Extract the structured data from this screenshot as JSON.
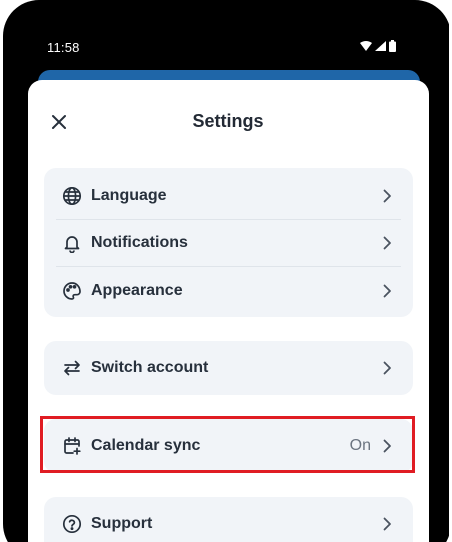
{
  "status_bar": {
    "time": "11:58",
    "icons": [
      "wifi-icon",
      "cellular-signal-icon",
      "battery-icon"
    ]
  },
  "header": {
    "title": "Settings",
    "close_icon": "close-icon"
  },
  "groups": {
    "general": {
      "items": [
        {
          "label": "Language",
          "icon": "globe-icon"
        },
        {
          "label": "Notifications",
          "icon": "bell-icon"
        },
        {
          "label": "Appearance",
          "icon": "palette-icon"
        }
      ]
    },
    "account": {
      "items": [
        {
          "label": "Switch account",
          "icon": "swap-arrows-icon"
        }
      ]
    },
    "calendar": {
      "items": [
        {
          "label": "Calendar sync",
          "value": "On",
          "icon": "calendar-add-icon"
        }
      ]
    },
    "help": {
      "items": [
        {
          "label": "Support",
          "icon": "help-circle-icon"
        }
      ]
    }
  },
  "colors": {
    "accent": "#1f66a8",
    "card_background": "#f1f4f8",
    "highlight_border": "#e01c23",
    "text_primary": "#27303c",
    "text_secondary": "#6b7480"
  }
}
